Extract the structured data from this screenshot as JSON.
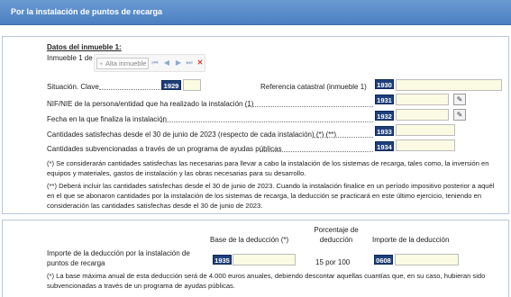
{
  "header": {
    "title": "Por la instalación de puntos de recarga"
  },
  "section": {
    "title": "Datos del inmueble 1:",
    "counter": "Inmueble 1 de 1",
    "alta_label": "Alta inmueble"
  },
  "rows": {
    "situacion": {
      "label": "Situación. Clave",
      "code": "1929"
    },
    "referencia": {
      "label": "Referencia catastral (inmueble 1)",
      "code": "1930"
    },
    "nif": {
      "label": "NIF/NIE de la persona/entidad que ha realizado la instalación (1)",
      "code": "1931"
    },
    "fecha": {
      "label": "Fecha en la que finaliza la instalación",
      "code": "1932"
    },
    "cantidades": {
      "label": "Cantidades satisfechas desde el 30 de junio de 2023 (respecto de cada instalación) (*) (**)",
      "code": "1933"
    },
    "subvencionadas": {
      "label": "Cantidades subvencionadas a través de un programa de ayudas públicas",
      "code": "1934"
    }
  },
  "notes": {
    "note1": "(*) Se considerarán cantidades satisfechas las necesarias para llevar a cabo la instalación de los sistemas de recarga, tales como, la inversión en equipos y materiales, gastos de instalación y las obras necesarias para su desarrollo.",
    "note2": "(**) Deberá incluir las cantidades satisfechas desde el 30 de junio de 2023. Cuando la instalación finalice en un período impositivo posterior a aquél en el que se abonaron cantidades por la instalación de los sistemas de recarga, la deducción se practicará en este último ejercicio, teniendo en consideración las cantidades satisfechas desde el 30 de junio de 2023."
  },
  "deduccion": {
    "col_base": "Base de la deducción (*)",
    "col_porcentaje": "Porcentaje de deducción",
    "col_importe": "Importe de la deducción",
    "label": "Importe de la deducción por la instalación de puntos de recarga",
    "code_base": "1935",
    "porcentaje_value": "15 por 100",
    "code_importe": "0608",
    "note": "(*) La base máxima anual de esta deducción será de 4.000 euros anuales, debiendo descontar aquellas cuantías que, en su caso, hubieran sido subvencionadas a través de un programa de ayudas públicas."
  }
}
